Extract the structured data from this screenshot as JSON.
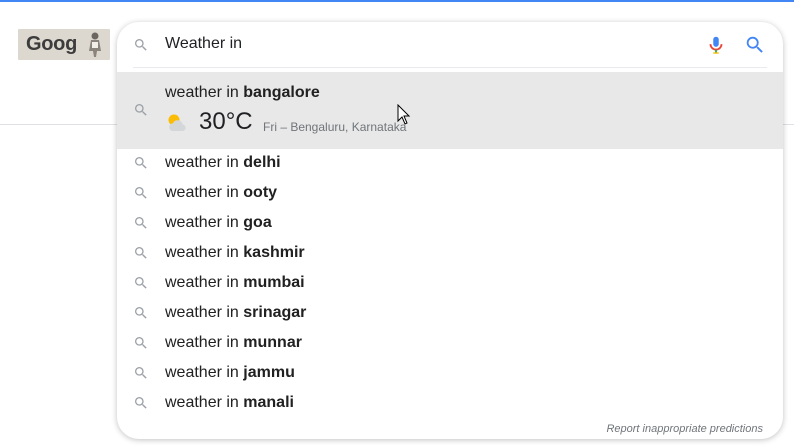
{
  "search": {
    "query": "Weather in",
    "icons": {
      "search": "search-icon",
      "mic": "mic-icon",
      "submit": "search-submit-icon"
    }
  },
  "highlighted": {
    "prefix": "weather in ",
    "bold": "bangalore",
    "temperature": "30°C",
    "detail": "Fri – Bengaluru, Karnataka",
    "weather_icon": "partly-cloudy-icon"
  },
  "suggestions": [
    {
      "prefix": "weather in ",
      "bold": "delhi"
    },
    {
      "prefix": "weather in ",
      "bold": "ooty"
    },
    {
      "prefix": "weather in ",
      "bold": "goa"
    },
    {
      "prefix": "weather in ",
      "bold": "kashmir"
    },
    {
      "prefix": "weather in ",
      "bold": "mumbai"
    },
    {
      "prefix": "weather in ",
      "bold": "srinagar"
    },
    {
      "prefix": "weather in ",
      "bold": "munnar"
    },
    {
      "prefix": "weather in ",
      "bold": "jammu"
    },
    {
      "prefix": "weather in ",
      "bold": "manali"
    }
  ],
  "footer": {
    "report_label": "Report inappropriate predictions"
  },
  "logo": {
    "text": "Goog"
  },
  "colors": {
    "accent": "#4285f4",
    "highlight_bg": "#e8e8e8",
    "mic_red": "#ea4335",
    "mic_blue": "#4285f4"
  }
}
